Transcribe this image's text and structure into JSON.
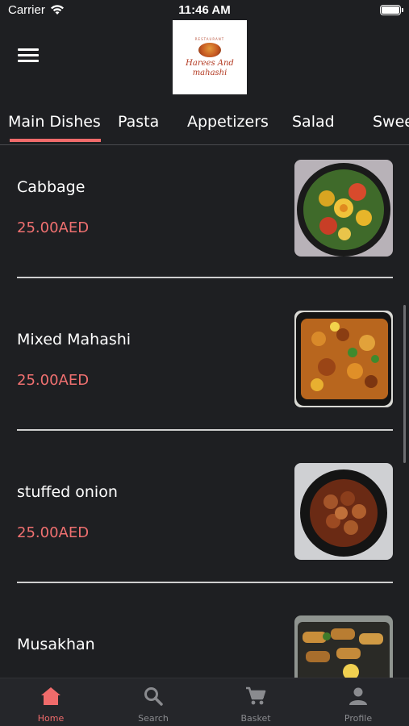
{
  "status_bar": {
    "carrier": "Carrier",
    "time": "11:46 AM"
  },
  "header": {
    "logo": {
      "small_text": "RESTAURANT",
      "line1": "Harees And",
      "line2": "mahashi"
    }
  },
  "tabs": [
    {
      "label": "Main Dishes",
      "active": true
    },
    {
      "label": "Pasta",
      "active": false
    },
    {
      "label": "Appetizers",
      "active": false
    },
    {
      "label": "Salad",
      "active": false
    },
    {
      "label": "Sweets",
      "active": false
    }
  ],
  "dishes": [
    {
      "name": "Cabbage",
      "price": "25.00AED"
    },
    {
      "name": "Mixed Mahashi",
      "price": "25.00AED"
    },
    {
      "name": "stuffed onion",
      "price": "25.00AED"
    },
    {
      "name": "Musakhan",
      "price": ""
    }
  ],
  "bottom_nav": [
    {
      "label": "Home",
      "icon": "home-icon",
      "active": true
    },
    {
      "label": "Search",
      "icon": "search-icon",
      "active": false
    },
    {
      "label": "Basket",
      "icon": "cart-icon",
      "active": false
    },
    {
      "label": "Profile",
      "icon": "profile-icon",
      "active": false
    }
  ],
  "colors": {
    "background": "#1e1f22",
    "accent": "#f06b6b",
    "nav_bg": "#25262a"
  }
}
